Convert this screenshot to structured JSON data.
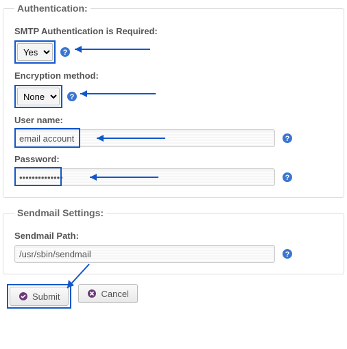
{
  "auth": {
    "legend": "Authentication:",
    "smtp_label": "SMTP Authentication is Required:",
    "smtp_value": "Yes",
    "encryption_label": "Encryption method:",
    "encryption_value": "None",
    "username_label": "User name:",
    "username_value": "email account",
    "password_label": "Password:",
    "password_value": "••••••••••••••"
  },
  "sendmail": {
    "legend": "Sendmail Settings:",
    "path_label": "Sendmail Path:",
    "path_value": "/usr/sbin/sendmail"
  },
  "buttons": {
    "submit": "Submit",
    "cancel": "Cancel"
  },
  "colors": {
    "highlight": "#1257c9",
    "help_fill": "#3a76d0"
  }
}
